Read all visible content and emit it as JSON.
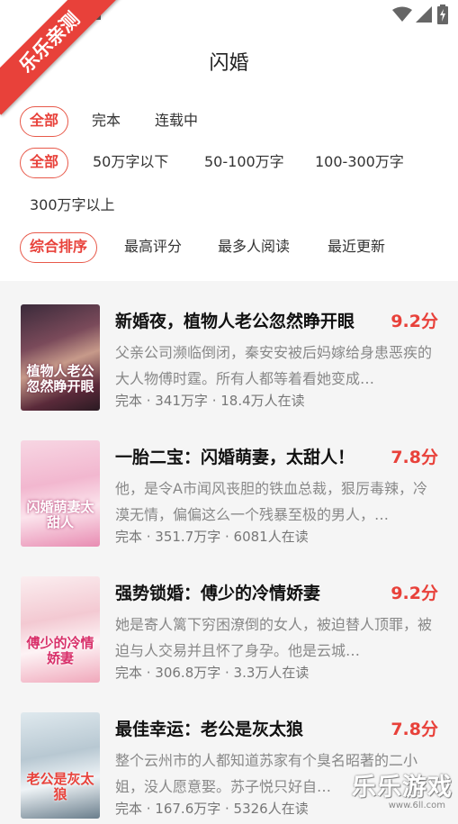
{
  "status_bar": {
    "icons": [
      "notification-icon",
      "text-icon",
      "wifi-icon",
      "signal-icon",
      "battery-icon"
    ]
  },
  "header": {
    "title": "闪婚"
  },
  "filters": {
    "completion": [
      "全部",
      "完本",
      "连载中"
    ],
    "word_count": [
      "全部",
      "50万字以下",
      "50-100万字",
      "100-300万字",
      "300万字以上"
    ],
    "sort": [
      "综合排序",
      "最高评分",
      "最多人阅读",
      "最近更新"
    ]
  },
  "books": [
    {
      "title": "新婚夜，植物人老公忽然睁开眼",
      "score": "9.2分",
      "desc": "父亲公司濒临倒闭，秦安安被后妈嫁给身患恶疾的大人物傅时霆。所有人都等着看她变成…",
      "meta": "完本 · 341万字 · 18.4万人在读",
      "cover_text": "植物人老公忽然睁开眼"
    },
    {
      "title": "一胎二宝：闪婚萌妻，太甜人！",
      "score": "7.8分",
      "desc": "他，是令A市闻风丧胆的铁血总裁，狠厉毒辣，冷漠无情，偏偏这么一个残暴至极的男人，…",
      "meta": "完本 · 351.7万字 · 6081人在读",
      "cover_text": "闪婚萌妻太甜人"
    },
    {
      "title": "强势锁婚：傅少的冷情娇妻",
      "score": "9.2分",
      "desc": "她是寄人篱下穷困潦倒的女人，被迫替人顶罪，被迫与人交易并且怀了身孕。他是云城…",
      "meta": "完本 · 306.8万字 · 3.3万人在读",
      "cover_text": "傅少的冷情娇妻"
    },
    {
      "title": "最佳幸运：老公是灰太狼",
      "score": "7.8分",
      "desc": "整个云州市的人都知道苏家有个臭名昭著的二小姐，没人愿意娶。苏子悦只好自…",
      "meta": "完本 · 167.6万字 · 5326人在读",
      "cover_text": "老公是灰太狼"
    }
  ],
  "ribbon": "乐乐亲测",
  "watermark": {
    "text": "乐乐游戏",
    "url": "www.6ll.com"
  },
  "colors": {
    "accent": "#e8413a",
    "background": "#f5f5f5"
  }
}
